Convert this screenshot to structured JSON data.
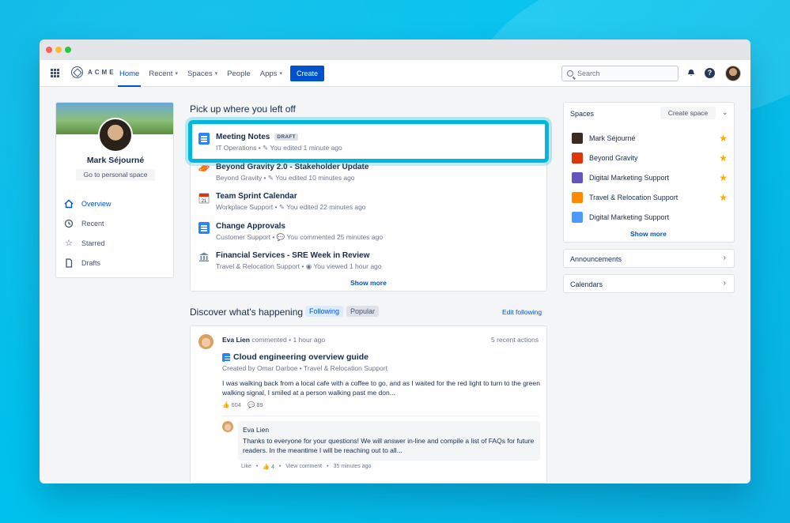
{
  "nav": {
    "logo_text": "ACME",
    "items": [
      {
        "label": "Home"
      },
      {
        "label": "Recent"
      },
      {
        "label": "Spaces"
      },
      {
        "label": "People"
      },
      {
        "label": "Apps"
      }
    ],
    "create_label": "Create",
    "search_placeholder": "Search",
    "help_glyph": "?"
  },
  "profile": {
    "name": "Mark Séjourné",
    "personal_space_label": "Go to personal space",
    "menu": [
      {
        "label": "Overview",
        "icon": "home-icon"
      },
      {
        "label": "Recent",
        "icon": "clock-icon"
      },
      {
        "label": "Starred",
        "icon": "star-outline-icon"
      },
      {
        "label": "Drafts",
        "icon": "document-icon"
      }
    ]
  },
  "recent": {
    "heading": "Pick up where you left off",
    "items": [
      {
        "title": "Meeting Notes",
        "badge": "DRAFT",
        "space": "IT Operations",
        "action": "You edited 1 minute ago",
        "icon": "document-icon"
      },
      {
        "title": "Beyond Gravity 2.0 - Stakeholder Update",
        "space": "Beyond Gravity",
        "action": "You edited 10 minutes ago",
        "icon": "planet-icon"
      },
      {
        "title": "Team Sprint Calendar",
        "space": "Workplace Support",
        "action": "You edited 22 minutes ago",
        "icon": "calendar-icon"
      },
      {
        "title": "Change Approvals",
        "space": "Customer Support",
        "action": "You commented 25 minutes ago",
        "icon": "document-icon"
      },
      {
        "title": "Financial Services - SRE Week in Review",
        "space": "Travel & Relocation Support",
        "action": "You viewed 1 hour ago",
        "icon": "bank-icon"
      }
    ],
    "show_more": "Show more"
  },
  "discover": {
    "heading": "Discover what's happening",
    "tabs": [
      "Following",
      "Popular"
    ],
    "edit_label": "Edit following",
    "feed": {
      "author": "Eva Lien",
      "verb": "commented",
      "time": "1 hour ago",
      "recent_actions": "5 recent actions",
      "title": "Cloud engineering overview guide",
      "created_by": "Created by Omar Darboe",
      "space": "Travel & Relocation Support",
      "body": "I was walking back from a local cafe with a coffee to go, and as I waited for the red light to turn to the green walking signal, I smiled at a person walking past me don...",
      "likes": "604",
      "comments": "89",
      "comment": {
        "author": "Eva Lien",
        "text": "Thanks to everyone for your questions! We will answer in-line and compile a list of FAQs for future readers. In the meantime I will be reaching out to all...",
        "like_label": "Like",
        "like_count": "4",
        "view_label": "View comment",
        "time": "35 minutes ago"
      }
    }
  },
  "spaces": {
    "heading": "Spaces",
    "create_label": "Create space",
    "items": [
      {
        "name": "Mark Séjourné",
        "starred": true,
        "color": "#3a2a20"
      },
      {
        "name": "Beyond Gravity",
        "starred": true,
        "color": "#de350b"
      },
      {
        "name": "Digital Marketing Support",
        "starred": true,
        "color": "#6554c0"
      },
      {
        "name": "Travel & Relocation Support",
        "starred": true,
        "color": "#ff8b00"
      },
      {
        "name": "Digital Marketing Support",
        "starred": false,
        "color": "#4c9aff"
      }
    ],
    "show_more": "Show more"
  },
  "announcements": {
    "label": "Announcements"
  },
  "calendars": {
    "label": "Calendars"
  }
}
